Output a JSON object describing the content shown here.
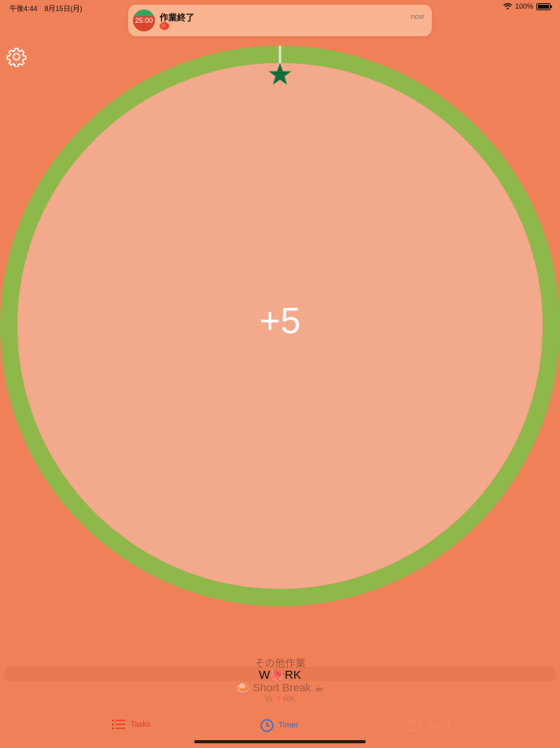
{
  "status_bar": {
    "time": "午後4:44　8月15日(月)",
    "battery": "100%",
    "battery_level": 1.0
  },
  "notification": {
    "icon_text": "25:00",
    "title": "作業終了",
    "time": "now"
  },
  "timer": {
    "value": "+5",
    "progress": 1.0
  },
  "colors": {
    "background": "#f08058",
    "ring": "#8fb84a",
    "inner": "#f2a98c",
    "star": "#0e6e3c"
  },
  "picker": {
    "above": "その他作業",
    "selected": "W🐙RK",
    "below": "🍛 Short Break ☕",
    "below2": "W🐙RK"
  },
  "tabs": [
    {
      "label": "Tasks",
      "icon": "list-icon"
    },
    {
      "label": "Timer",
      "icon": "clock-icon"
    },
    {
      "label": "Report",
      "icon": "calendar-icon"
    }
  ]
}
